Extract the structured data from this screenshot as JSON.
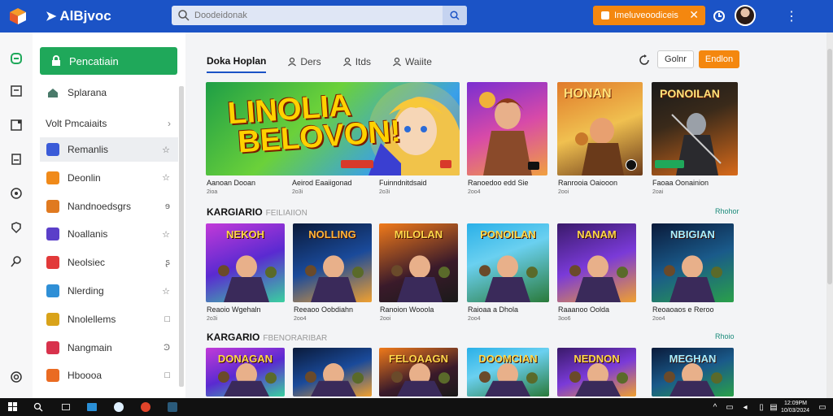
{
  "topbar": {
    "brand": "AlBjvoc",
    "search_placeholder": "Doodeidonak",
    "promo_label": "Imeluveoodiceis",
    "promo_close": "✕",
    "menu_icon": "⋮"
  },
  "sidebar": {
    "primary_button": "Pencatiain",
    "first_item": "Splarana",
    "section_header": "Volt Pmcaiaits",
    "items": [
      {
        "label": "Remanlis",
        "trail": "☆",
        "color": "#3a5bd8"
      },
      {
        "label": "Deonlin",
        "trail": "☆",
        "color": "#f08a1a"
      },
      {
        "label": "Nandnoedsgrs",
        "trail": "ɘ",
        "color": "#e07a20"
      },
      {
        "label": "Noallanis",
        "trail": "☆",
        "color": "#5b3fc9"
      },
      {
        "label": "Neolsiec",
        "trail": "ʂ",
        "color": "#e23a3a"
      },
      {
        "label": "Nlerding",
        "trail": "☆",
        "color": "#2f8fd6"
      },
      {
        "label": "Nnolellems",
        "trail": "□",
        "color": "#d9a31a"
      },
      {
        "label": "Nangmain",
        "trail": "Ͽ",
        "color": "#d8324c"
      },
      {
        "label": "Hboooa",
        "trail": "□",
        "color": "#ea6b22"
      }
    ]
  },
  "main": {
    "tabs": [
      {
        "label": "Doka Hoplan",
        "active": true
      },
      {
        "label": "Ders"
      },
      {
        "label": "Itds"
      },
      {
        "label": "Waiite"
      }
    ],
    "btn_outline": "Golnr",
    "btn_orange": "Endlon",
    "featured": {
      "title_line1": "LINOLIA",
      "title_line2": "BELOVON!",
      "cards": [
        {
          "caption": "Aanoan Dooan",
          "sub": "2ioa"
        },
        {
          "caption": "Aeirod Eaaiigonad",
          "sub": "2o3i"
        },
        {
          "caption": "Fuinndnitdsaid",
          "sub": "2o3i"
        },
        {
          "caption": "Ranoedoo edd Sie",
          "sub": "2oo4"
        },
        {
          "caption": "Ranrooia Oaiooon",
          "sub": "2ooi"
        },
        {
          "caption": "Faoaa Oonainion",
          "sub": "2oai"
        }
      ],
      "art_titles": [
        "",
        "",
        "HONAN",
        "PONOILAN"
      ]
    },
    "section1": {
      "title": "KARGIARIO",
      "faint": "FEILIAIION",
      "link": "Rhohor",
      "cards": [
        {
          "caption": "Reaoio Wgehaln",
          "sub": "2o3i",
          "art": "NEKOH"
        },
        {
          "caption": "Reeaoo Oobdiahn",
          "sub": "2oo4",
          "art": "NOLLING"
        },
        {
          "caption": "Ranoion Wooola",
          "sub": "2ooi",
          "art": "MILOLAN"
        },
        {
          "caption": "Raioaa a Dhola",
          "sub": "2oo4",
          "art": "PONOILAN"
        },
        {
          "caption": "Raaanoo Oolda",
          "sub": "3oo6",
          "art": "NANAM"
        },
        {
          "caption": "Reoaoaos e Reroo",
          "sub": "2oo4",
          "art": "NBIGIAN"
        }
      ]
    },
    "section2": {
      "title": "KARGARIO",
      "faint": "FBENORARIBAR",
      "link": "Rhoio",
      "cards": [
        {
          "art": "DONAGAN"
        },
        {
          "art": ""
        },
        {
          "art": "FELOAAGN"
        },
        {
          "art": "DOOMCIAN"
        },
        {
          "art": "NEDNON"
        },
        {
          "art": "MEGHAN"
        }
      ]
    }
  },
  "taskbar": {
    "time": "12:09PM",
    "date": "10/03/2024"
  },
  "colors": {
    "topbar": "#1b53c6",
    "primary": "#1fa85a",
    "accent": "#f4870f"
  }
}
